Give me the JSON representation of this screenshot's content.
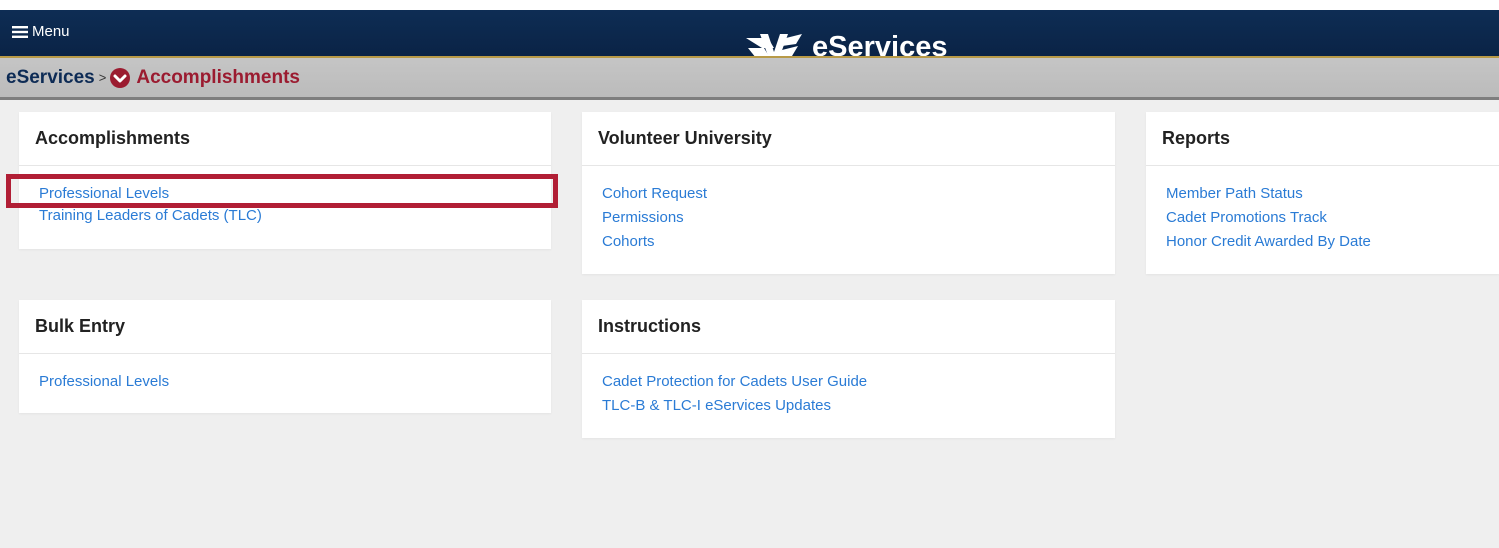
{
  "header": {
    "menu_label": "Menu",
    "brand_name": "eServices"
  },
  "breadcrumb": {
    "root": "eServices",
    "separator": ">",
    "current": "Accomplishments"
  },
  "panels": {
    "accomplishments": {
      "title": "Accomplishments",
      "links": [
        "Professional Levels",
        "Training Leaders of Cadets (TLC)"
      ]
    },
    "volunteer_university": {
      "title": "Volunteer University",
      "links": [
        "Cohort Request",
        "Permissions",
        "Cohorts"
      ]
    },
    "reports": {
      "title": "Reports",
      "links": [
        "Member Path Status",
        "Cadet Promotions Track",
        "Honor Credit Awarded By Date"
      ]
    },
    "bulk_entry": {
      "title": "Bulk Entry",
      "links": [
        "Professional Levels"
      ]
    },
    "instructions": {
      "title": "Instructions",
      "links": [
        "Cadet Protection for Cadets User Guide",
        "TLC-B & TLC-I eServices Updates"
      ]
    }
  },
  "icons": {
    "menu": "hamburger-icon",
    "logo": "eservices-logo-icon",
    "breadcrumb": "chevron-circle-down-icon"
  },
  "colors": {
    "header_bg": "#0e2d54",
    "breadcrumb_accent": "#9b1b30",
    "link": "#2a7bd5",
    "highlight": "#b11e35"
  }
}
